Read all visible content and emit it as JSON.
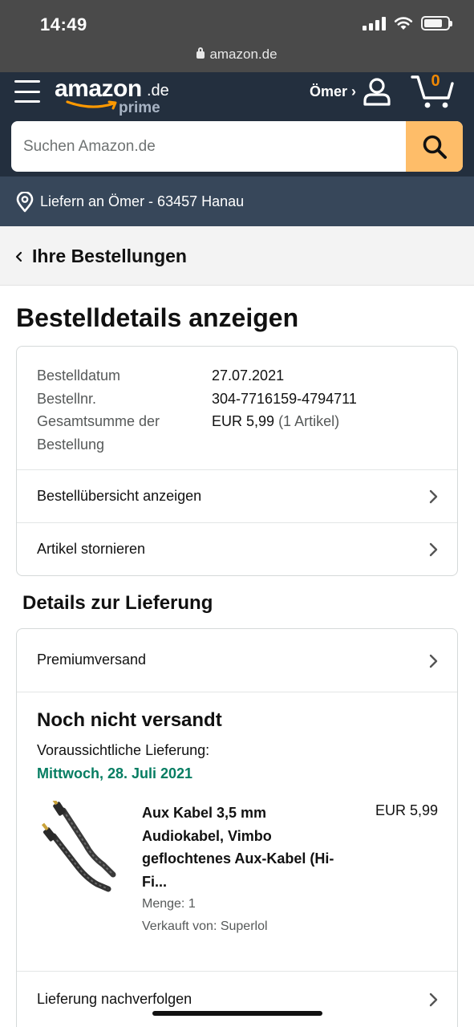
{
  "status_bar": {
    "time": "14:49",
    "url": "amazon.de"
  },
  "header": {
    "logo_text": "amazon",
    "logo_suffix": ".de",
    "logo_sub": "prime",
    "account_label": "Ömer ›",
    "cart_count": "0",
    "brand_accent": "#febd69",
    "header_bg": "#232f3e"
  },
  "search": {
    "placeholder": "Suchen Amazon.de",
    "value": ""
  },
  "deliver_to": {
    "label": "Liefern an Ömer - 63457 Hanau"
  },
  "breadcrumb": {
    "label": "Ihre Bestellungen"
  },
  "page": {
    "title": "Bestelldetails anzeigen"
  },
  "order_info": {
    "rows": [
      {
        "label": "Bestelldatum",
        "value": "27.07.2021"
      },
      {
        "label": "Bestellnr.",
        "value": "304-7716159-4794711"
      },
      {
        "label": "Gesamtsumme der",
        "value": "EUR 5,99",
        "extra": "(1 Artikel)"
      },
      {
        "label": "Bestellung",
        "value": ""
      }
    ],
    "links": [
      {
        "label": "Bestellübersicht anzeigen"
      },
      {
        "label": "Artikel stornieren"
      }
    ]
  },
  "delivery": {
    "section_title": "Details zur Lieferung",
    "shipping_method": "Premiumversand",
    "status": "Noch nicht versandt",
    "estimate_label": "Voraussichtliche Lieferung:",
    "estimate_date": "Mittwoch, 28. Juli 2021",
    "estimate_color": "#067d62",
    "item": {
      "title": "Aux Kabel 3,5 mm Audiokabel, Vimbo geflochtenes Aux-Kabel (Hi-Fi...",
      "price": "EUR 5,99",
      "quantity": "Menge: 1",
      "seller": "Verkauft von: Superlol"
    },
    "track_label": "Lieferung nachverfolgen"
  }
}
